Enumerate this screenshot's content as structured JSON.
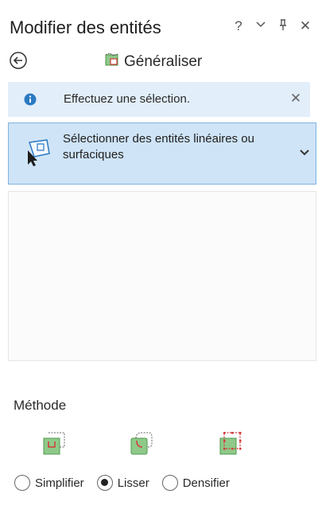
{
  "pane": {
    "title": "Modifier des entités",
    "controls": {
      "help": "?",
      "options": "⌄",
      "pin": "ᵽ",
      "close": "✕"
    }
  },
  "tool": {
    "back_icon": "back-arrow-circle-icon",
    "name": "Généraliser",
    "icon": "generalize-icon"
  },
  "info": {
    "icon": "info-icon",
    "message": "Effectuez une sélection.",
    "close": "✕"
  },
  "selection": {
    "label": "Sélectionner des entités linéaires ou surfaciques",
    "icon": "select-features-icon",
    "chevron": "chevron-down-icon"
  },
  "method": {
    "label": "Méthode",
    "icons": [
      "simplify-icon",
      "smooth-icon",
      "densify-icon"
    ],
    "options": [
      {
        "label": "Simplifier",
        "checked": false
      },
      {
        "label": "Lisser",
        "checked": true
      },
      {
        "label": "Densifier",
        "checked": false
      }
    ]
  },
  "colors": {
    "info_bg": "#e2eef9",
    "selected_bg": "#cfe4f7",
    "accent_blue": "#2b79c2",
    "green": "#8fc98a",
    "red": "#d23b3b"
  }
}
